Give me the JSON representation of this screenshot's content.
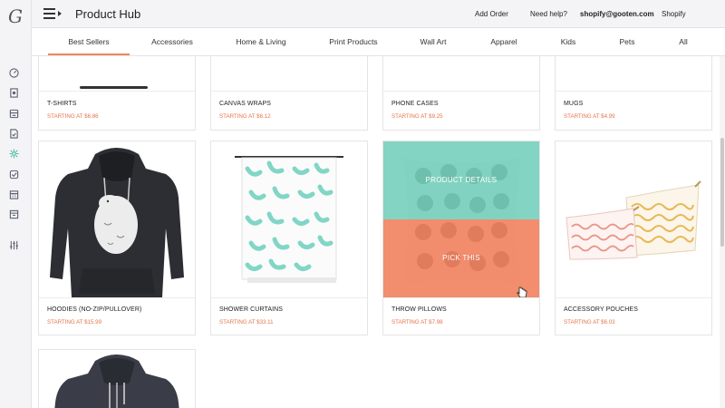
{
  "app": {
    "logo": "G",
    "title": "Product Hub"
  },
  "header_nav": {
    "add_order": "Add Order",
    "need_help": "Need help?",
    "account": "shopify@gooten.com",
    "platform": "Shopify",
    "cart_icon": "cart-icon"
  },
  "rail_icons": [
    "dashboard-icon",
    "orders-icon",
    "store-icon",
    "document-icon",
    "product-hub-icon",
    "checklist-icon",
    "calendar-icon",
    "archive-icon",
    "settings-sliders-icon"
  ],
  "tabs": [
    "Best Sellers",
    "Accessories",
    "Home & Living",
    "Print Products",
    "Wall Art",
    "Apparel",
    "Kids",
    "Pets",
    "All"
  ],
  "active_tab": "Best Sellers",
  "products_row1": [
    {
      "name": "T-SHIRTS",
      "price": "STARTING AT $6.86"
    },
    {
      "name": "CANVAS WRAPS",
      "price": "STARTING AT $6.12"
    },
    {
      "name": "PHONE CASES",
      "price": "STARTING AT $9.25"
    },
    {
      "name": "MUGS",
      "price": "STARTING AT $4.99"
    }
  ],
  "products_row2": [
    {
      "name": "HOODIES (NO-ZIP/PULLOVER)",
      "price": "STARTING AT $15.99"
    },
    {
      "name": "SHOWER CURTAINS",
      "price": "STARTING AT $33.11"
    },
    {
      "name": "THROW PILLOWS",
      "price": "STARTING AT $7.98"
    },
    {
      "name": "ACCESSORY POUCHES",
      "price": "STARTING AT $6.03"
    }
  ],
  "hover_overlay": {
    "details": "PRODUCT DETAILS",
    "pick": "PICK THIS"
  },
  "colors": {
    "accent": "#e98a5e",
    "price": "#e4744a",
    "teal": "#6ecdb9",
    "coral": "#f07d5a"
  }
}
